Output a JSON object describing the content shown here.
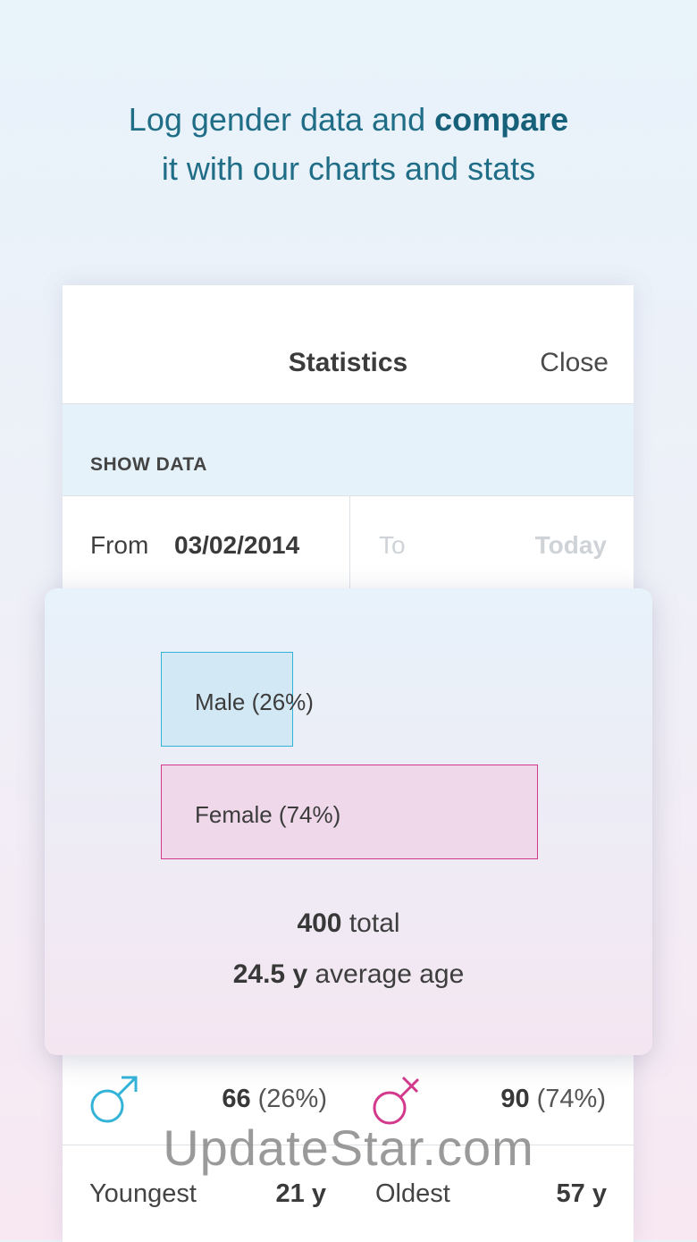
{
  "headline": {
    "line1_regular": "Log gender data and ",
    "line1_bold": "compare",
    "line2": "it with our charts and stats"
  },
  "statistics": {
    "title": "Statistics",
    "close_label": "Close",
    "section_label": "SHOW DATA",
    "from_label": "From",
    "from_date": "03/02/2014",
    "to_label": "To",
    "to_value": "Today"
  },
  "chart_data": {
    "type": "bar",
    "categories": [
      "Male (26%)",
      "Female (74%)"
    ],
    "values": [
      26,
      74
    ],
    "orientation": "horizontal",
    "colors": [
      "#33b3d8",
      "#d3398b"
    ]
  },
  "summary": {
    "total_value": "400",
    "total_label": " total",
    "avg_value": "24.5 y",
    "avg_label": " average age"
  },
  "counts": {
    "male_value": "66",
    "male_pct": " (26%)",
    "female_value": "90",
    "female_pct": " (74%)",
    "male_icon": "male-symbol-icon",
    "female_icon": "female-symbol-icon"
  },
  "ages": {
    "youngest_label": "Youngest",
    "youngest_value": "21 y",
    "oldest_label": "Oldest",
    "oldest_value": "57 y"
  },
  "watermark": "UpdateStar.com"
}
